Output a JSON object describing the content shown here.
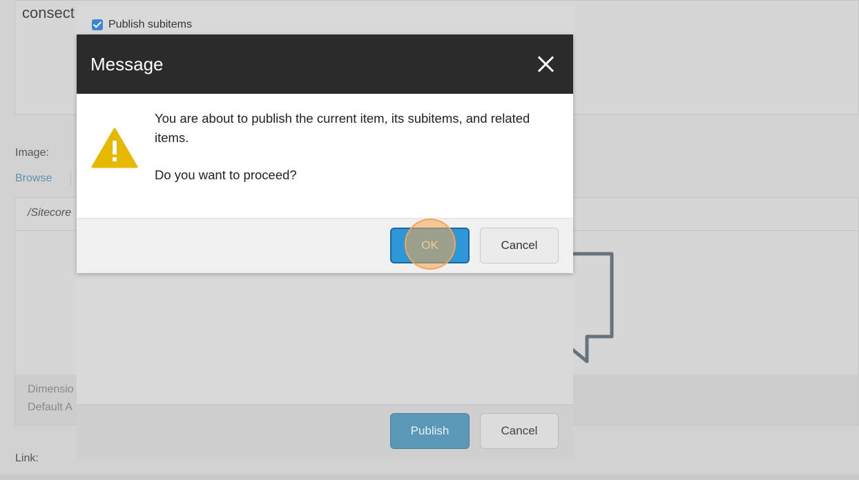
{
  "background_page": {
    "text_snippet": "consect",
    "image_label": "Image:",
    "browse_link": "Browse",
    "image_path": "/Sitecore",
    "dimensions_label": "Dimensio",
    "default_alt_label": "Default A",
    "link_label": "Link:"
  },
  "publish_dialog": {
    "publish_subitems_label": "Publish subitems",
    "publish_subitems_checked": true,
    "publish_button": "Publish",
    "cancel_button": "Cancel"
  },
  "message_dialog": {
    "title": "Message",
    "line1": "You are about to publish the current item, its subitems, and related items.",
    "line2": "Do you want to proceed?",
    "ok_button": "OK",
    "cancel_button": "Cancel",
    "warning_icon": "warning-triangle-icon",
    "close_icon": "close-icon"
  },
  "colors": {
    "header_bg": "#2b2b2b",
    "ok_button": "#2e97d6",
    "warning_yellow": "#e6b800",
    "click_highlight": "#f3a35a"
  }
}
